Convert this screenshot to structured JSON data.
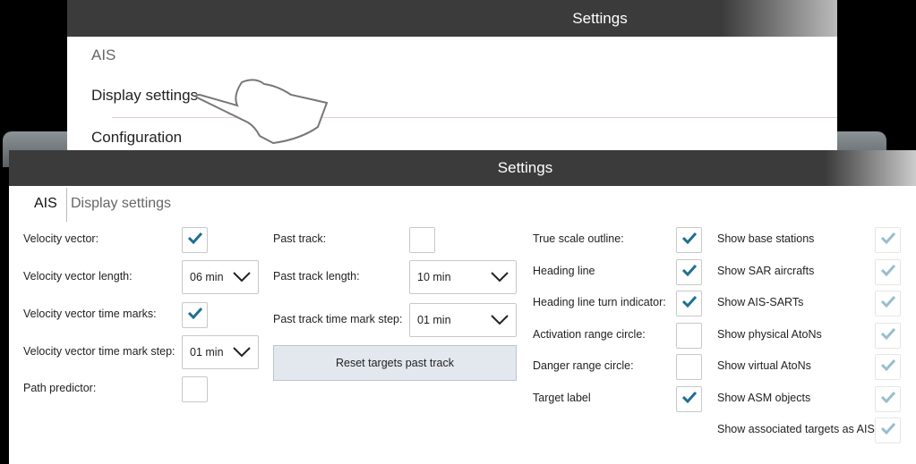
{
  "back_panel": {
    "title": "Settings",
    "items": [
      "AIS",
      "Display settings",
      "Configuration"
    ]
  },
  "front_panel": {
    "title": "Settings",
    "breadcrumb": {
      "root": "AIS",
      "current": "Display settings"
    },
    "col1": [
      {
        "label": "Velocity vector:",
        "type": "checkbox",
        "checked": true
      },
      {
        "label": "Velocity vector length:",
        "type": "dropdown",
        "value": "06 min"
      },
      {
        "label": "Velocity vector time marks:",
        "type": "checkbox",
        "checked": true
      },
      {
        "label": "Velocity vector time mark step:",
        "type": "dropdown",
        "value": "01 min"
      },
      {
        "label": "Path predictor:",
        "type": "checkbox",
        "checked": false
      }
    ],
    "col2": [
      {
        "label": "Past track:",
        "type": "checkbox",
        "checked": false
      },
      {
        "label": "Past track length:",
        "type": "dropdown",
        "value": "10 min"
      },
      {
        "label": "Past track time mark step:",
        "type": "dropdown",
        "value": "01 min"
      }
    ],
    "reset_button": "Reset targets past track",
    "col3": [
      {
        "label": "True scale outline:",
        "checked": true
      },
      {
        "label": "Heading line",
        "checked": true
      },
      {
        "label": "Heading line turn indicator:",
        "checked": true
      },
      {
        "label": "Activation range circle:",
        "checked": false
      },
      {
        "label": "Danger range circle:",
        "checked": false
      },
      {
        "label": "Target label",
        "checked": true
      }
    ],
    "col4": [
      {
        "label": "Show base stations",
        "checked": true,
        "disabled": true
      },
      {
        "label": "Show SAR aircrafts",
        "checked": true,
        "disabled": true
      },
      {
        "label": "Show AIS-SARTs",
        "checked": true,
        "disabled": true
      },
      {
        "label": "Show physical AtoNs",
        "checked": true,
        "disabled": true
      },
      {
        "label": "Show virtual AtoNs",
        "checked": true,
        "disabled": true
      },
      {
        "label": "Show ASM objects",
        "checked": true,
        "disabled": true
      },
      {
        "label": "Show associated targets as AIS",
        "checked": true,
        "disabled": true
      }
    ]
  },
  "colors": {
    "check": "#1f6f94",
    "header": "#3b3b3b",
    "button": "#e3e8ef"
  }
}
